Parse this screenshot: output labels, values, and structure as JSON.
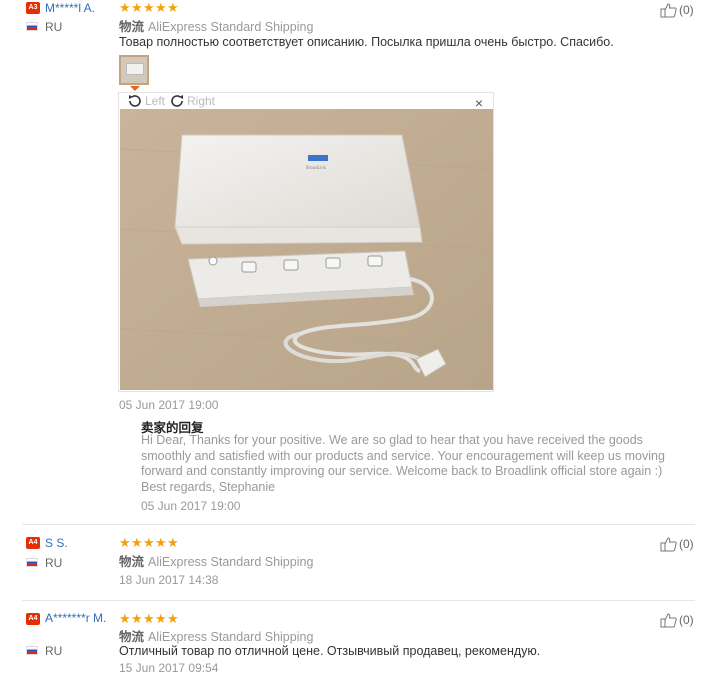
{
  "reviews": [
    {
      "badge": "A3",
      "username": "M*****l A.",
      "country": "RU",
      "rating": 5,
      "shipping_label": "物流",
      "shipping_method": "AliExpress Standard Shipping",
      "text": "Товар полностью соответствует описанию. Посылка пришла очень быстро. Спасибо.",
      "date": "05 Jun 2017 19:00",
      "helpful": "(0)",
      "image_viewer": {
        "rotate_left": "Left",
        "rotate_right": "Right",
        "close": "×"
      },
      "photo_brand_label": "BroadLink",
      "seller_reply": {
        "title": "卖家的回复",
        "body": "Hi Dear, Thanks for your positive. We are so glad to hear that you have received the goods smoothly and satisfied with our products and service. Your encouragement will keep us moving forward and constantly improving our service. Welcome back to Broadlink official store again :)",
        "signature": "Best regards, Stephanie",
        "date": "05 Jun 2017 19:00"
      }
    },
    {
      "badge": "A4",
      "username": "S S.",
      "country": "RU",
      "rating": 5,
      "shipping_label": "物流",
      "shipping_method": "AliExpress Standard Shipping",
      "date": "18 Jun 2017 14:38",
      "helpful": "(0)"
    },
    {
      "badge": "A4",
      "username": "A*******r M.",
      "country": "RU",
      "rating": 5,
      "shipping_label": "物流",
      "shipping_method": "AliExpress Standard Shipping",
      "text": "Отличный товар по отличной цене. Отзывчивый продавец, рекомендую.",
      "date": "15 Jun 2017 09:54",
      "helpful": "(0)"
    }
  ],
  "icons": {
    "star": "star-icon",
    "thumb": "thumbs-up-icon",
    "rotate_left": "rotate-left-icon",
    "rotate_right": "rotate-right-icon",
    "close": "close-icon",
    "flag": "russia-flag-icon"
  },
  "colors": {
    "star": "#f2a10f",
    "badge": "#e62e04",
    "username": "#2f6fbf",
    "muted": "#999999"
  }
}
